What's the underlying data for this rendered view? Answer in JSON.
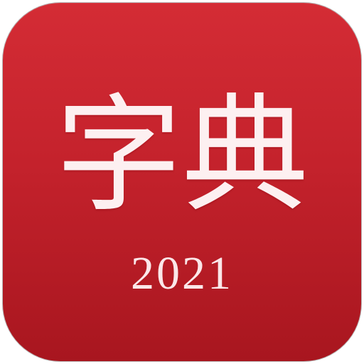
{
  "icon": {
    "title_chars": [
      "字",
      "典"
    ],
    "year": "2021",
    "colors": {
      "background_top": "#d42c35",
      "background_bottom": "#a8161f",
      "text": "#fdf0f1",
      "border": "#b9b9b9"
    }
  }
}
